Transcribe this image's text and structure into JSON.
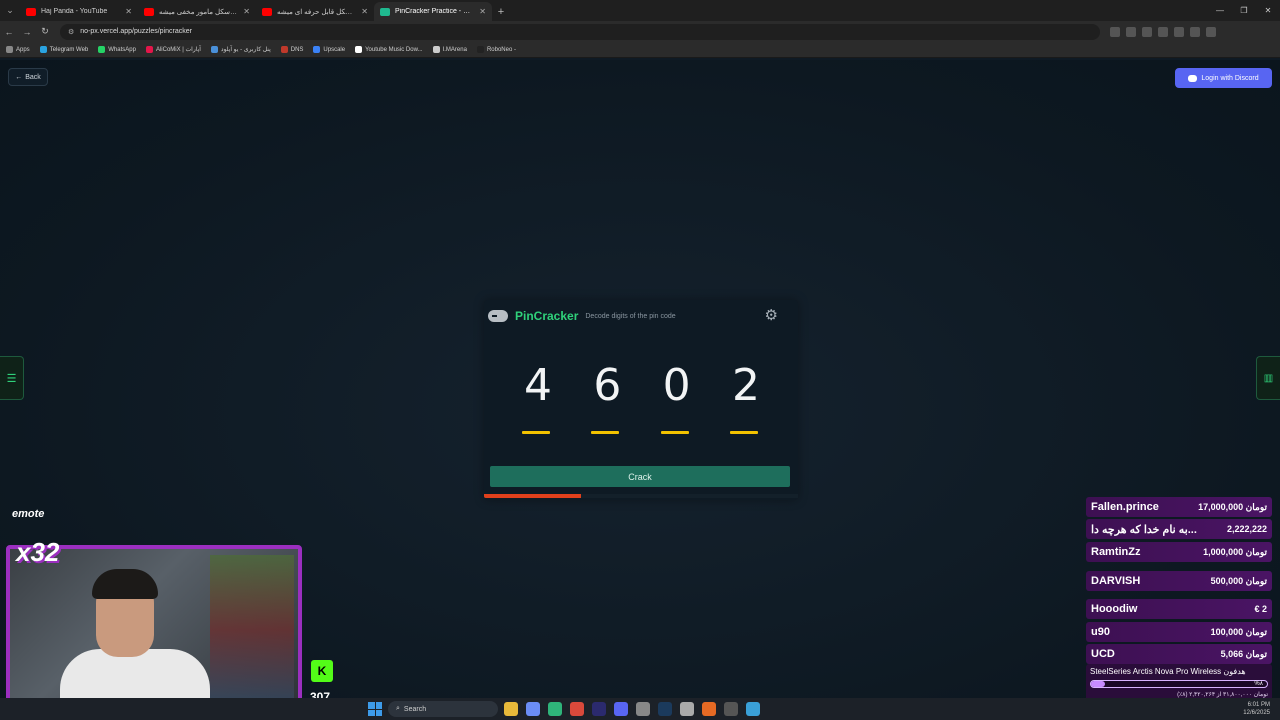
{
  "browser": {
    "tabs": [
      {
        "label": "Haj Panda - YouTube",
        "icon": "youtube-icon",
        "active": false
      },
      {
        "label": "وقتی یه اسکل مامور مخفی میشه",
        "icon": "youtube-icon",
        "active": false
      },
      {
        "label": "وقتی یه اسکل قابل حرفه ای میشه",
        "icon": "youtube-icon",
        "active": false
      },
      {
        "label": "PinCracker Practice - NoPi",
        "icon": "pincracker-icon",
        "active": true
      }
    ],
    "url": "no-px.vercel.app/puzzles/pincracker",
    "bookmarks": [
      "Apps",
      "Telegram Web",
      "WhatsApp",
      "AliCoMiX | آپارات",
      "پنل کاربری - یو آپلود",
      "DNS",
      "Upscale",
      "Youtube Music Dow...",
      "I.MArena",
      "RoboNeo -"
    ]
  },
  "page": {
    "back_label": "Back",
    "discord_label": "Login with Discord",
    "game": {
      "title": "PinCracker",
      "subtitle": "Decode digits of the pin code",
      "digits": [
        "4",
        "6",
        "0",
        "2"
      ],
      "crack_label": "Crack",
      "timer_fraction": 0.31,
      "colors": {
        "accent": "#2fd17a",
        "bar": "#f2c200",
        "button": "#1e6e5c",
        "timer": "#e0401c"
      }
    }
  },
  "stream": {
    "emote_label": "emote",
    "multiplier": "x32",
    "viewers": "307",
    "donations": [
      {
        "name": "Fallen.prince",
        "amount": "17,000,000 تومان"
      },
      {
        "name": "به نام خدا که هرچه دا...",
        "amount": "2,222,222"
      },
      {
        "name": "RamtinZz",
        "amount": "1,000,000 تومان"
      },
      {
        "name": "DARVISH",
        "amount": "500,000 تومان"
      },
      {
        "name": "Hooodiw",
        "amount": "€ 2"
      },
      {
        "name": "u90",
        "amount": "100,000 تومان"
      },
      {
        "name": "UCD",
        "amount": "5,066 تومان"
      }
    ],
    "goal": {
      "title": "SteelSeries Arctis Nova Pro Wireless هدفون",
      "percent": "%٨",
      "fraction": 0.08,
      "progress_text": "(٪۸) تومان ۳۱,۸۰۰,۰۰۰ از ۲,۴۲۰,۲۶۴"
    }
  },
  "taskbar": {
    "search_label": "Search",
    "clock": "6:01 PM",
    "date": "12/6/2025"
  }
}
